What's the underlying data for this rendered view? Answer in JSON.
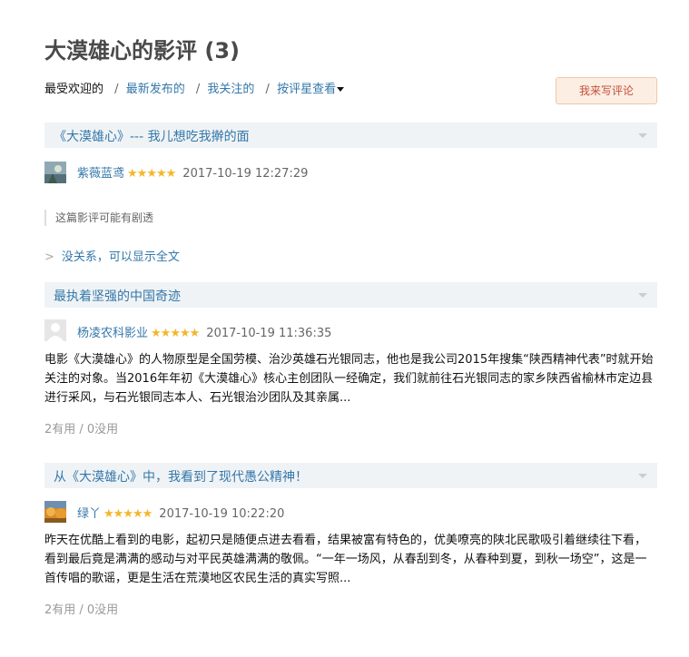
{
  "page": {
    "title": "大漠雄心的影评 (3)"
  },
  "sort": {
    "items": [
      {
        "label": "最受欢迎的"
      },
      {
        "label": "最新发布的"
      },
      {
        "label": "我关注的"
      },
      {
        "label": "按评星查看"
      }
    ],
    "separator": "/",
    "current_index": 0
  },
  "write_button": {
    "label": "我来写评论"
  },
  "reviews": [
    {
      "title": "《大漠雄心》--- 我儿想吃我擀的面",
      "author": "紫薇蓝鸢",
      "rating": 5,
      "stars": "★★★★★",
      "time": "2017-10-19 12:27:29",
      "spoiler_note": "这篇影评可能有剧透",
      "show_full": "没关系，可以显示全文",
      "show_full_chevron": ">"
    },
    {
      "title": "最执着坚强的中国奇迹",
      "author": "杨凌农科影业",
      "rating": 5,
      "stars": "★★★★★",
      "time": "2017-10-19 11:36:35",
      "excerpt": "电影《大漠雄心》的人物原型是全国劳模、治沙英雄石光银同志，他也是我公司2015年搜集“陕西精神代表”时就开始关注的对象。当2016年年初《大漠雄心》核心主创团队一经确定，我们就前往石光银同志的家乡陕西省榆林市定边县进行采风，与石光银同志本人、石光银治沙团队及其亲属...",
      "useful": "2有用 / 0没用"
    },
    {
      "title": "从《大漠雄心》中，我看到了现代愚公精神！",
      "author": "绿丫",
      "rating": 5,
      "stars": "★★★★★",
      "time": "2017-10-19 10:22:20",
      "excerpt": "昨天在优酷上看到的电影，起初只是随便点进去看看，结果被富有特色的，优美嘹亮的陕北民歌吸引着继续往下看，看到最后竟是满满的感动与对平民英雄满满的敬佩。“一年一场风，从春刮到冬，从春种到夏，到秋一场空”，这是一首传唱的歌谣，更是生活在荒漠地区农民生活的真实写照...",
      "useful": "2有用 / 0没用"
    }
  ],
  "colors": {
    "link": "#3377aa",
    "star": "#f4b62b",
    "header_bg": "#f0f3f5",
    "button_bg": "#fdeee3",
    "button_text": "#c0513b"
  },
  "icons": {
    "toggle": "triangle-down-icon",
    "sort_caret": "caret-down-icon",
    "chevron": "chevron-right-icon"
  }
}
